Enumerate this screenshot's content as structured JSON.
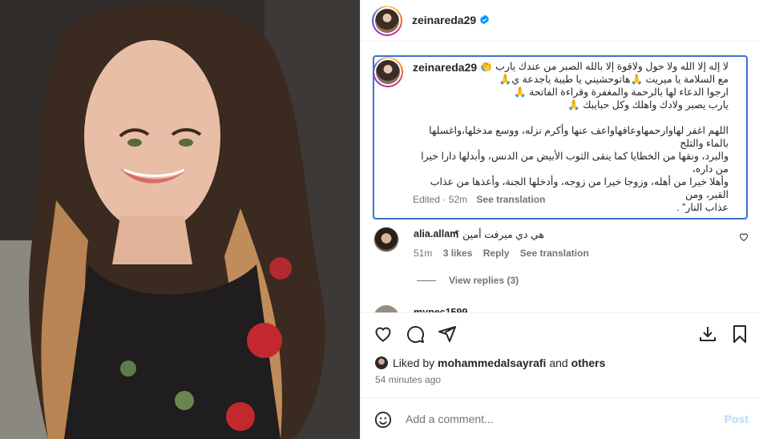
{
  "post": {
    "author": "zeinareda29",
    "verified": true
  },
  "caption": {
    "author": "zeinareda29",
    "lines": [
      "لا إله إلا الله ولا حول ولاقوة إلا بالله الصبر من عندك يارب 👏",
      "مع السلامة يا ميريت 🙏هاتوحشيني يا طيبة ياجدعة ي🙏",
      "ارجوا الدعاء لها بالرحمة والمغفرة وقراءة الفاتحة 🙏",
      "يارب يصبر ولادك واهلك وكل حبايبك 🙏",
      "",
      "اللهم اغفر لهاوارحمهاوعافهاواعف عنها وأكرم نزله، ووسع مدخلها،واغسلها بالماء والثلج",
      "والبرد، ونقها من الخطايا كما ينقى الثوب الأبيض من الدنس، وأبدلها دارا خيرا من داره،",
      "وأهلا خيرا من أهله، وزوجا خيرا من زوجه، وأدخلها الجنة، وأعذها من عذاب القبر، ومن",
      "عذاب النار” ."
    ],
    "edited": "Edited",
    "age": "52m",
    "see_translation": "See translation"
  },
  "comment": {
    "author": "alia.allam",
    "text": "هي دي ميرفت أمين ؟",
    "age": "51m",
    "likes": "3 likes",
    "reply": "Reply",
    "see_translation": "See translation",
    "view_replies": "View replies (3)"
  },
  "next_comment_partial": "mynec1599 ...",
  "likes": {
    "prefix": "Liked by",
    "user": "mohammedalsayrafi",
    "and": "and",
    "others": "others",
    "time": "54 minutes ago"
  },
  "composer": {
    "placeholder": "Add a comment...",
    "post_label": "Post"
  },
  "colors": {
    "verified": "#0095f6",
    "focus_border": "#3d6fd6",
    "post_disabled": "#b3dbff",
    "muted": "#737373"
  },
  "icons": [
    "like-icon",
    "comment-icon",
    "share-icon",
    "download-icon",
    "save-icon",
    "emoji-icon",
    "heart-icon",
    "verified-badge-icon"
  ]
}
